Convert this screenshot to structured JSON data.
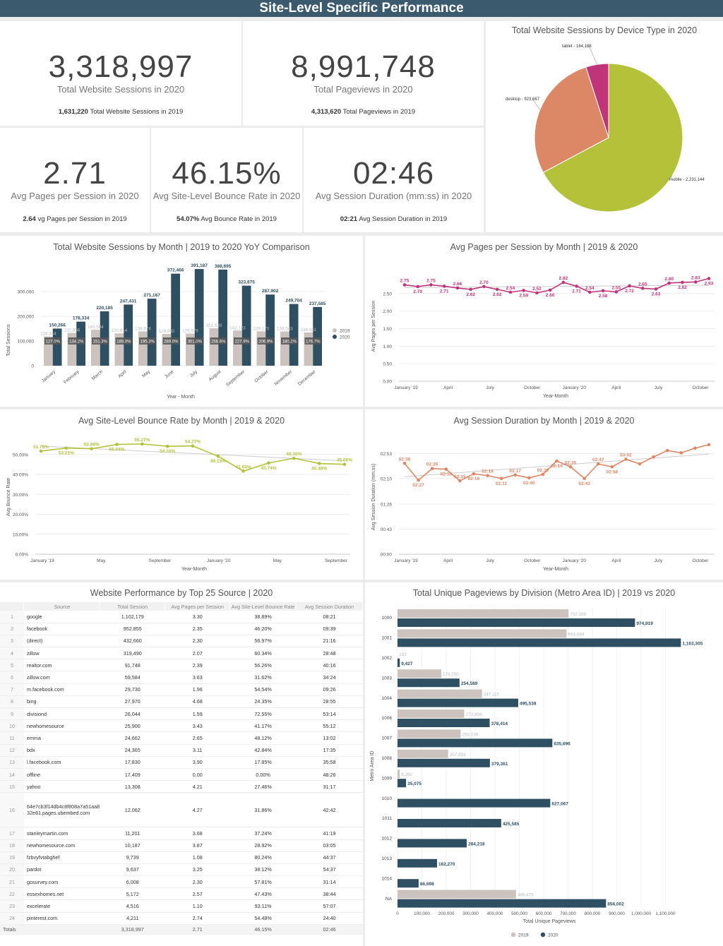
{
  "header": {
    "title": "Site-Level Specific Performance"
  },
  "kpis": {
    "sessions": {
      "value": "3,318,997",
      "label": "Total Website Sessions in 2020",
      "sub_value": "1,631,220",
      "sub_label": "Total Website Sessions in 2019"
    },
    "pageviews": {
      "value": "8,991,748",
      "label": "Total Pageviews in 2020",
      "sub_value": "4,313,620",
      "sub_label": "Total Pageviews in 2019"
    },
    "pages_per_session": {
      "value": "2.71",
      "label": "Avg Pages per Session in 2020",
      "sub_value": "2.64",
      "sub_label": "vg Pages per Session in 2019"
    },
    "bounce": {
      "value": "46.15%",
      "label": "Avg Site-Level Bounce Rate in 2020",
      "sub_value": "54.07%",
      "sub_label": "Avg Bounce Rate in 2019"
    },
    "duration": {
      "value": "02:46",
      "label": "Avg Session Duration (mm:ss) in 2020",
      "sub_value": "02:21",
      "sub_label": "Avg Session Duration in 2019"
    }
  },
  "charts": {
    "device": {
      "title": "Total Website Sessions by Device Type in 2020"
    },
    "sessions_month": {
      "title": "Total Website Sessions by Month | 2019 to 2020 YoY Comparison",
      "ylabel": "Total Sessions",
      "xlabel": "Year - Month"
    },
    "pps_month": {
      "title": "Avg Pages per Session by Month | 2019 & 2020",
      "ylabel": "Avg Pages per Session",
      "xlabel": "Year-Month"
    },
    "bounce_month": {
      "title": "Avg Site-Level Bounce Rate by Month | 2019 & 2020",
      "ylabel": "Avg Bounce Rate",
      "xlabel": "Year-Month"
    },
    "duration_month": {
      "title": "Avg Session Duration by Month | 2019 & 2020",
      "ylabel": "Avg Session Duration (mm:ss)",
      "xlabel": "Year-Month"
    },
    "source": {
      "title": "Website Performance by Top 25 Source | 2020"
    },
    "division": {
      "title": "Total Unique Pageviews by Division (Metro Area ID) | 2019 vs 2020",
      "ylabel": "Metro Area ID",
      "xlabel": "Total Unique Pageviews"
    }
  },
  "source_table": {
    "headers": [
      "Source",
      "Total Session",
      "Avg Pages per Session",
      "Avg Site-Level Bounce Rate",
      "Avg Session Duration"
    ],
    "rows": [
      [
        "1",
        "google",
        "1,102,179",
        "3.30",
        "38.89%",
        "08:21"
      ],
      [
        "2",
        "facebook",
        "952,855",
        "2.35",
        "46.20%",
        "09:39"
      ],
      [
        "3",
        "(direct)",
        "432,660",
        "2.30",
        "56.97%",
        "21:16"
      ],
      [
        "4",
        "zillow",
        "319,490",
        "2.07",
        "60.34%",
        "28:48"
      ],
      [
        "5",
        "realtor.com",
        "91,748",
        "2.39",
        "56.26%",
        "40:16"
      ],
      [
        "6",
        "zillow.com",
        "59,584",
        "3.63",
        "31.62%",
        "34:24"
      ],
      [
        "7",
        "m.facebook.com",
        "29,730",
        "1.96",
        "54.54%",
        "09:26"
      ],
      [
        "8",
        "bing",
        "27,970",
        "4.68",
        "24.35%",
        "28:55"
      ],
      [
        "9",
        "divisiond",
        "26,044",
        "1.59",
        "72.55%",
        "53:14"
      ],
      [
        "10",
        "newhomesource",
        "25,900",
        "3.43",
        "41.17%",
        "55:12"
      ],
      [
        "11",
        "emma",
        "24,662",
        "2.65",
        "48.12%",
        "13:02"
      ],
      [
        "12",
        "bdx",
        "24,365",
        "3.11",
        "42.84%",
        "17:35"
      ],
      [
        "13",
        "l.facebook.com",
        "17,830",
        "3.90",
        "17.85%",
        "35:58"
      ],
      [
        "14",
        "offline",
        "17,409",
        "0.00",
        "0.00%",
        "48:26"
      ],
      [
        "15",
        "yahoo",
        "13,308",
        "4.21",
        "27.46%",
        "31:17"
      ],
      [
        "16",
        "64e7cb3f14db4c8f808a7a51aa832e81.pages.ubembed.com",
        "12,062",
        "4.27",
        "31.86%",
        "42:42"
      ],
      [
        "17",
        "stanleymartin.com",
        "11,201",
        "3.68",
        "37.24%",
        "41:19"
      ],
      [
        "18",
        "newhomesource.com",
        "10,187",
        "3.87",
        "28.92%",
        "03:05"
      ],
      [
        "19",
        "fzbvyfvtabghef",
        "9,739",
        "1.08",
        "80.24%",
        "44:37"
      ],
      [
        "20",
        "pardot",
        "9,637",
        "3.25",
        "38.12%",
        "54:37"
      ],
      [
        "21",
        "gosurvey.com",
        "6,008",
        "2.30",
        "57.81%",
        "31:14"
      ],
      [
        "22",
        "essexhomes.net",
        "5,172",
        "2.57",
        "47.43%",
        "38:44"
      ],
      [
        "23",
        "excelerate",
        "4,516",
        "1.10",
        "93.11%",
        "57:07"
      ],
      [
        "24",
        "pinterest.com",
        "4,211",
        "2.74",
        "54.48%",
        "24:40"
      ]
    ],
    "totals": [
      "Totals",
      "",
      "3,318,997",
      "2.71",
      "46.15%",
      "02:46"
    ]
  },
  "chart_data": [
    {
      "type": "pie",
      "title": "Total Website Sessions by Device Type in 2020",
      "slices": [
        {
          "label": "mobile",
          "value": 2231144,
          "color": "#b4c23a"
        },
        {
          "label": "desktop",
          "value": 923667,
          "color": "#dc8866"
        },
        {
          "label": "tablet",
          "value": 164186,
          "color": "#c0357a"
        }
      ]
    },
    {
      "type": "bar",
      "title": "Total Website Sessions by Month | 2019 to 2020 YoY Comparison",
      "categories": [
        "January",
        "February",
        "March",
        "April",
        "May",
        "June",
        "July",
        "August",
        "September",
        "October",
        "November",
        "December"
      ],
      "series": [
        {
          "name": "2019",
          "color": "#cdc3be",
          "values": [
            118344,
            132856,
            145504,
            130814,
            138874,
            128892,
            129978,
            151539,
            142123,
            139170,
            138543,
            134451
          ]
        },
        {
          "name": "2020",
          "color": "#2f4f62",
          "values": [
            150266,
            178334,
            220185,
            247431,
            271167,
            372466,
            391187,
            388895,
            323875,
            287902,
            249704,
            237585
          ]
        }
      ],
      "growth_labels": [
        "127.0%",
        "134.2%",
        "151.3%",
        "189.0%",
        "195.3%",
        "289.0%",
        "301.0%",
        "256.6%",
        "227.9%",
        "206.9%",
        "180.2%",
        "176.7%"
      ],
      "ylim": [
        0,
        400000
      ],
      "yticks": [
        "0",
        "100,000",
        "200,000",
        "300,000"
      ]
    },
    {
      "type": "line",
      "title": "Avg Pages per Session by Month | 2019 & 2020",
      "x": [
        "January '19",
        "April",
        "July",
        "October",
        "January '20",
        "April",
        "July",
        "October"
      ],
      "values": [
        2.75,
        2.7,
        2.75,
        2.71,
        2.66,
        2.62,
        2.7,
        2.62,
        2.54,
        2.59,
        2.52,
        2.6,
        2.82,
        2.71,
        2.54,
        2.58,
        2.55,
        2.72,
        2.65,
        2.63,
        2.8,
        2.82,
        2.83,
        2.93
      ],
      "ylim": [
        0,
        2.9
      ],
      "yticks": [
        "0.00",
        "0.50",
        "1.00",
        "1.50",
        "2.00",
        "2.50"
      ],
      "color": "#c0357a"
    },
    {
      "type": "line",
      "title": "Avg Site-Level Bounce Rate by Month | 2019 & 2020",
      "x": [
        "January '19",
        "May",
        "September",
        "January '20",
        "May",
        "September"
      ],
      "values": [
        51.7,
        53.21,
        52.88,
        55.04,
        55.27,
        54.1,
        54.27,
        49.15,
        41.65,
        45.74,
        48.1,
        45.48,
        45.06
      ],
      "label_values": [
        "51.70%",
        "53.21%",
        "52.88%",
        "55.04%",
        "55.27%",
        "54.10%",
        "54.27%",
        "49.15%",
        "41.65%",
        "45.74%",
        "48.10%",
        "45.48%",
        "45.06%"
      ],
      "ylim": [
        0,
        57
      ],
      "yticks": [
        "0.00%",
        "10.00%",
        "20.00%",
        "30.00%",
        "40.00%",
        "50.00%"
      ],
      "color": "#b4c23a"
    },
    {
      "type": "line",
      "title": "Avg Session Duration by Month | 2019 & 2020",
      "x": [
        "January '19",
        "April",
        "July",
        "October",
        "January '20",
        "April",
        "July",
        "October"
      ],
      "values": [
        156,
        127,
        147,
        146,
        126,
        138,
        135,
        130,
        136,
        131,
        137,
        160,
        150,
        130,
        155,
        150,
        163,
        155,
        167,
        178,
        174,
        182,
        188
      ],
      "label_values": [
        "02:36",
        "02:27",
        "02:26",
        "02:18",
        "02:15",
        "02:10",
        "02:16",
        "02:11",
        "02:17",
        "02:40",
        "02:30",
        "02:14",
        "02:35",
        "02:43",
        "02:47",
        "02:58",
        "03:02"
      ],
      "ylim": [
        0,
        200
      ],
      "yticks": [
        "00:00",
        "00:43",
        "01:26",
        "02:10",
        "02:53"
      ],
      "color": "#dc8866"
    },
    {
      "type": "bar",
      "title": "Total Unique Pageviews by Division (Metro Area ID) | 2019 vs 2020",
      "categories": [
        "1000",
        "1001",
        "1002",
        "1003",
        "1004",
        "1006",
        "1007",
        "1008",
        "1009",
        "1010",
        "1011",
        "1012",
        "1013",
        "1014",
        "NA"
      ],
      "series": [
        {
          "name": "2019",
          "color": "#cdc3be",
          "values": [
            702168,
            694088,
            193,
            179750,
            347115,
            273994,
            259036,
            207803,
            9262,
            0,
            0,
            0,
            0,
            0,
            486479
          ]
        },
        {
          "name": "2020",
          "color": "#2f4f62",
          "values": [
            974919,
            1163305,
            9427,
            254589,
            495538,
            378414,
            635696,
            379361,
            35075,
            627067,
            425585,
            284218,
            162270,
            86698,
            856002
          ]
        }
      ],
      "xlim": [
        0,
        1200000
      ],
      "xticks": [
        "0",
        "100,000",
        "200,000",
        "300,000",
        "400,000",
        "500,000",
        "600,000",
        "700,000",
        "800,000",
        "900,000",
        "1,000,000",
        "1,100,000"
      ]
    }
  ]
}
